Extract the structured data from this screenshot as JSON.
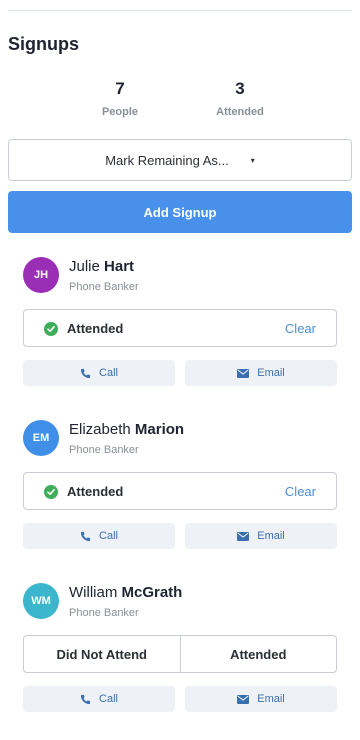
{
  "section": {
    "title": "Signups"
  },
  "stats": {
    "people": {
      "value": "7",
      "label": "People"
    },
    "attended": {
      "value": "3",
      "label": "Attended"
    }
  },
  "mark_select": {
    "label": "Mark Remaining As...",
    "caret": "▾"
  },
  "add_button": {
    "label": "Add Signup"
  },
  "colors": {
    "primary": "#4990ea",
    "success": "#3fae5b",
    "link": "#4a8fd6"
  },
  "people": [
    {
      "initials": "JH",
      "first": "Julie",
      "last": "Hart",
      "role": "Phone Banker",
      "avatar_color": "#9a2fb5",
      "status": "Attended",
      "clear_label": "Clear",
      "call_label": "Call",
      "email_label": "Email"
    },
    {
      "initials": "EM",
      "first": "Elizabeth",
      "last": "Marion",
      "role": "Phone Banker",
      "avatar_color": "#3f8ee8",
      "status": "Attended",
      "clear_label": "Clear",
      "call_label": "Call",
      "email_label": "Email"
    },
    {
      "initials": "WM",
      "first": "William",
      "last": "McGrath",
      "role": "Phone Banker",
      "avatar_color": "#3bb6cc",
      "options": [
        "Did Not Attend",
        "Attended"
      ],
      "call_label": "Call",
      "email_label": "Email"
    }
  ]
}
